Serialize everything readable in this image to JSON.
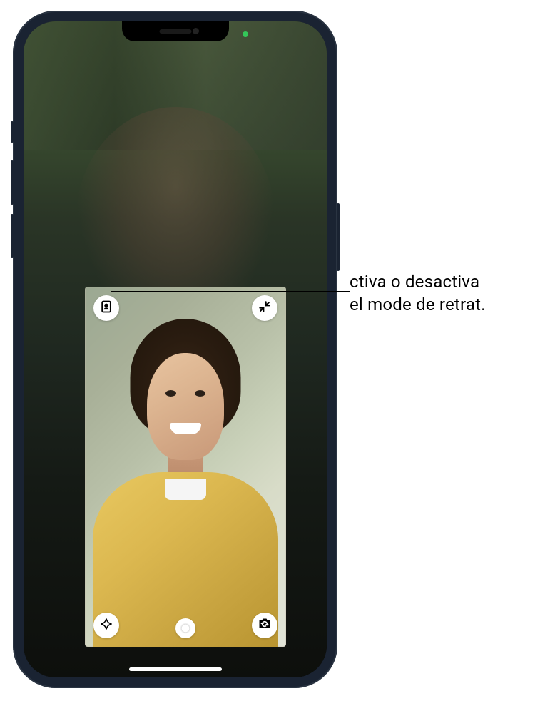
{
  "callout": {
    "line1": "ctiva o desactiva",
    "line2": "el mode de retrat."
  },
  "pip_controls": {
    "portrait_mode": "portrait-mode-icon",
    "minimize": "minimize-icon",
    "effects": "effects-icon",
    "shutter": "shutter-icon",
    "flip_camera": "flip-camera-icon"
  },
  "status": {
    "camera_active_color": "#34c759"
  }
}
